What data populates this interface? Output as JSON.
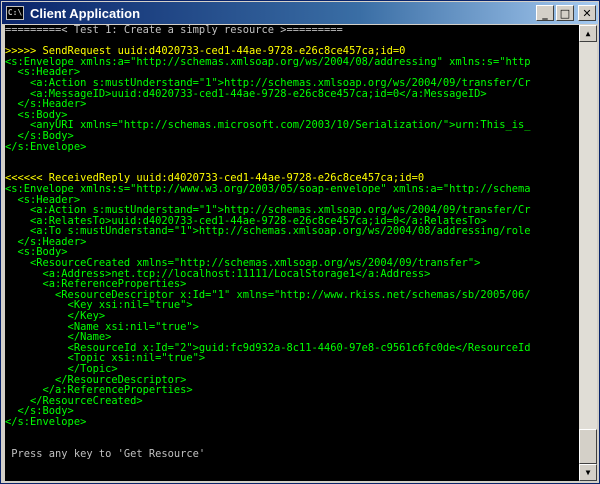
{
  "window": {
    "title": "Client Application",
    "icon_label": "C:\\",
    "controls": {
      "minimize": "_",
      "maximize": "□",
      "close": "✕"
    }
  },
  "scrollbar": {
    "up_arrow": "▲",
    "down_arrow": "▼"
  },
  "colors": {
    "console_bg": "#000000",
    "default_text": "#c0c0c0",
    "header_text": "#ffff00",
    "xml_text": "#00ff00"
  },
  "console_lines": [
    {
      "style": "white",
      "text": "=========< Test 1: Create a simply resource >========="
    },
    {
      "style": "white",
      "text": ""
    },
    {
      "style": "yellow",
      "text": ">>>>> SendRequest uuid:d4020733-ced1-44ae-9728-e26c8ce457ca;id=0"
    },
    {
      "style": "green",
      "text": "<s:Envelope xmlns:a=\"http://schemas.xmlsoap.org/ws/2004/08/addressing\" xmlns:s=\"http"
    },
    {
      "style": "green",
      "text": "  <s:Header>"
    },
    {
      "style": "green",
      "text": "    <a:Action s:mustUnderstand=\"1\">http://schemas.xmlsoap.org/ws/2004/09/transfer/Cr"
    },
    {
      "style": "green",
      "text": "    <a:MessageID>uuid:d4020733-ced1-44ae-9728-e26c8ce457ca;id=0</a:MessageID>"
    },
    {
      "style": "green",
      "text": "  </s:Header>"
    },
    {
      "style": "green",
      "text": "  <s:Body>"
    },
    {
      "style": "green",
      "text": "    <anyURI xmlns=\"http://schemas.microsoft.com/2003/10/Serialization/\">urn:This_is_"
    },
    {
      "style": "green",
      "text": "  </s:Body>"
    },
    {
      "style": "green",
      "text": "</s:Envelope>"
    },
    {
      "style": "white",
      "text": ""
    },
    {
      "style": "white",
      "text": ""
    },
    {
      "style": "yellow",
      "text": "<<<<<< ReceivedReply uuid:d4020733-ced1-44ae-9728-e26c8ce457ca;id=0"
    },
    {
      "style": "green",
      "text": "<s:Envelope xmlns:s=\"http://www.w3.org/2003/05/soap-envelope\" xmlns:a=\"http://schema"
    },
    {
      "style": "green",
      "text": "  <s:Header>"
    },
    {
      "style": "green",
      "text": "    <a:Action s:mustUnderstand=\"1\">http://schemas.xmlsoap.org/ws/2004/09/transfer/Cr"
    },
    {
      "style": "green",
      "text": "    <a:RelatesTo>uuid:d4020733-ced1-44ae-9728-e26c8ce457ca;id=0</a:RelatesTo>"
    },
    {
      "style": "green",
      "text": "    <a:To s:mustUnderstand=\"1\">http://schemas.xmlsoap.org/ws/2004/08/addressing/role"
    },
    {
      "style": "green",
      "text": "  </s:Header>"
    },
    {
      "style": "green",
      "text": "  <s:Body>"
    },
    {
      "style": "green",
      "text": "    <ResourceCreated xmlns=\"http://schemas.xmlsoap.org/ws/2004/09/transfer\">"
    },
    {
      "style": "green",
      "text": "      <a:Address>net.tcp://localhost:11111/LocalStorage1</a:Address>"
    },
    {
      "style": "green",
      "text": "      <a:ReferenceProperties>"
    },
    {
      "style": "green",
      "text": "        <ResourceDescriptor x:Id=\"1\" xmlns=\"http://www.rkiss.net/schemas/sb/2005/06/"
    },
    {
      "style": "green",
      "text": "          <Key xsi:nil=\"true\">"
    },
    {
      "style": "green",
      "text": "          </Key>"
    },
    {
      "style": "green",
      "text": "          <Name xsi:nil=\"true\">"
    },
    {
      "style": "green",
      "text": "          </Name>"
    },
    {
      "style": "green",
      "text": "          <ResourceId x:Id=\"2\">guid:fc9d932a-8c11-4460-97e8-c9561c6fc0de</ResourceId"
    },
    {
      "style": "green",
      "text": "          <Topic xsi:nil=\"true\">"
    },
    {
      "style": "green",
      "text": "          </Topic>"
    },
    {
      "style": "green",
      "text": "        </ResourceDescriptor>"
    },
    {
      "style": "green",
      "text": "      </a:ReferenceProperties>"
    },
    {
      "style": "green",
      "text": "    </ResourceCreated>"
    },
    {
      "style": "green",
      "text": "  </s:Body>"
    },
    {
      "style": "green",
      "text": "</s:Envelope>"
    },
    {
      "style": "white",
      "text": ""
    },
    {
      "style": "white",
      "text": ""
    },
    {
      "style": "white",
      "text": " Press any key to 'Get Resource'"
    }
  ]
}
